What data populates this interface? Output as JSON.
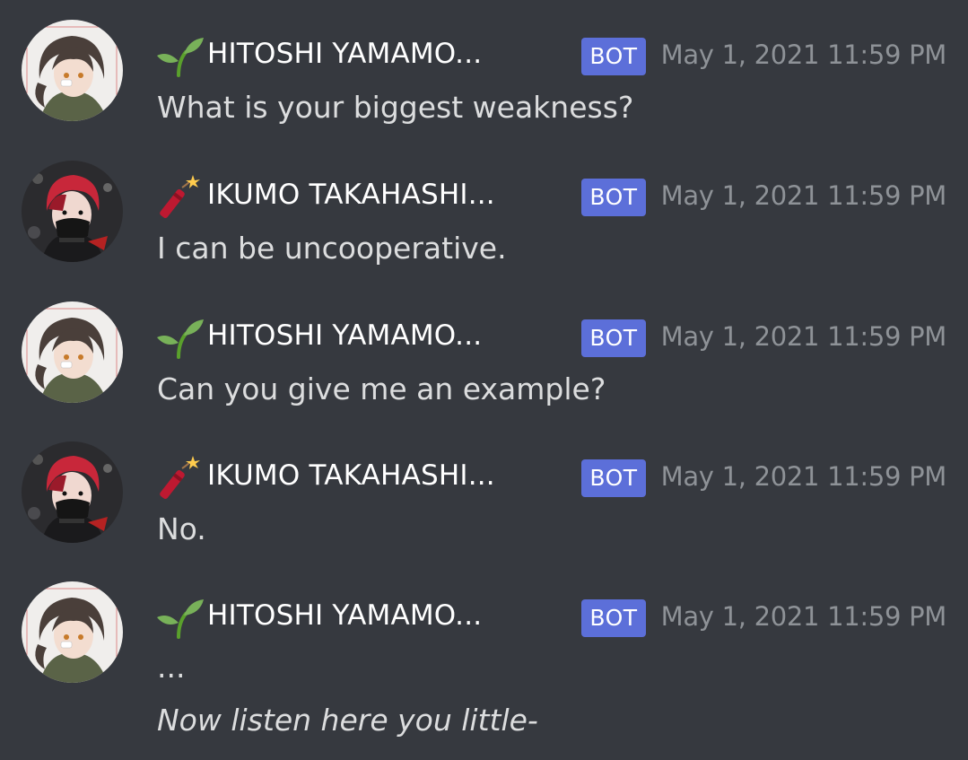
{
  "messages": [
    {
      "author": "HITOSHI YAMAMO...",
      "role_icon": "seedling-icon",
      "avatar": "hitoshi-avatar",
      "tag": "BOT",
      "timestamp": "May 1, 2021 11:59 PM",
      "lines": [
        "What is your biggest weakness?"
      ]
    },
    {
      "author": "IKUMO TAKAHASHI...",
      "role_icon": "firecracker-icon",
      "avatar": "ikumo-avatar",
      "tag": "BOT",
      "timestamp": "May 1, 2021 11:59 PM",
      "lines": [
        "I can be uncooperative."
      ]
    },
    {
      "author": "HITOSHI YAMAMO...",
      "role_icon": "seedling-icon",
      "avatar": "hitoshi-avatar",
      "tag": "BOT",
      "timestamp": "May 1, 2021 11:59 PM",
      "lines": [
        "Can you give me an example?"
      ]
    },
    {
      "author": "IKUMO TAKAHASHI...",
      "role_icon": "firecracker-icon",
      "avatar": "ikumo-avatar",
      "tag": "BOT",
      "timestamp": "May 1, 2021 11:59 PM",
      "lines": [
        "No."
      ]
    },
    {
      "author": "HITOSHI YAMAMO...",
      "role_icon": "seedling-icon",
      "avatar": "hitoshi-avatar",
      "tag": "BOT",
      "timestamp": "May 1, 2021 11:59 PM",
      "lines": [
        "...",
        "Now listen here you little-"
      ]
    }
  ],
  "colors": {
    "background": "#36393f",
    "username": "#ffffff",
    "message_text": "#dcddde",
    "timestamp": "#8e9297",
    "bot_tag": "#5c6fd9"
  }
}
